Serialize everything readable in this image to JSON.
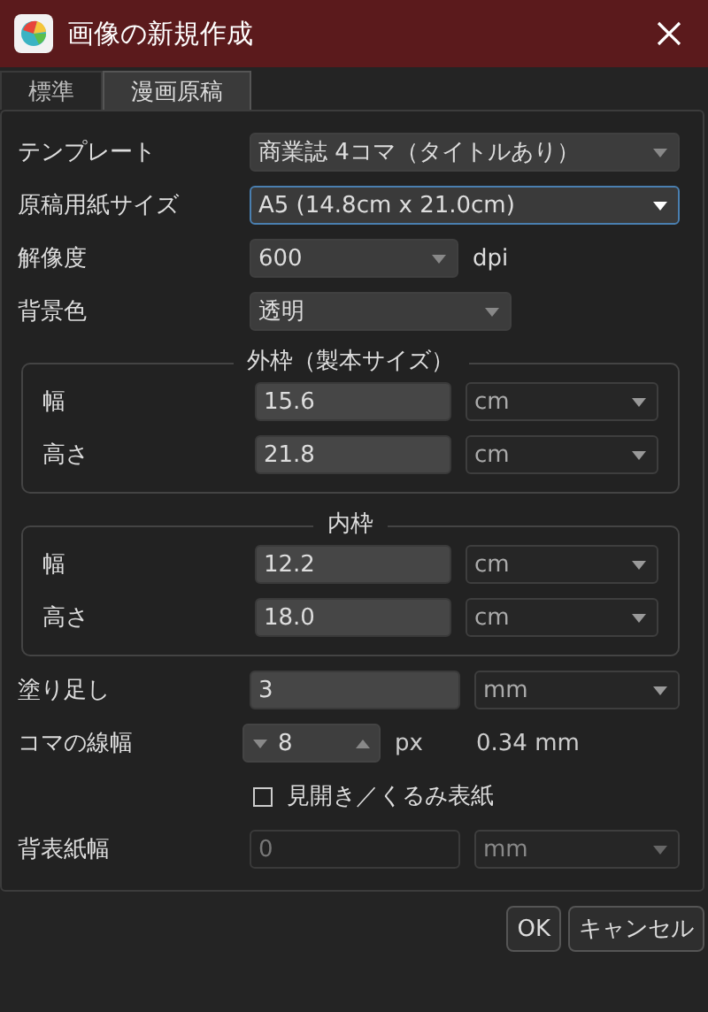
{
  "window": {
    "title": "画像の新規作成"
  },
  "tabs": [
    {
      "label": "標準",
      "selected": false
    },
    {
      "label": "漫画原稿",
      "selected": true
    }
  ],
  "rows": [
    {
      "kind": "select",
      "label": "テンプレート",
      "value": "商業誌 4コマ（タイトルあり）",
      "focused": false
    },
    {
      "kind": "select",
      "label": "原稿用紙サイズ",
      "value": "A5 (14.8cm x 21.0cm)",
      "focused": true
    },
    {
      "kind": "select",
      "label": "解像度",
      "value": "600",
      "unit": "dpi",
      "focused": false
    },
    {
      "kind": "select",
      "label": "背景色",
      "value": "透明",
      "focused": false
    },
    {
      "kind": "group",
      "title": "外枠（製本サイズ）",
      "rows": [
        {
          "label": "幅",
          "value": "15.6",
          "unit": "cm"
        },
        {
          "label": "高さ",
          "value": "21.8",
          "unit": "cm"
        }
      ]
    },
    {
      "kind": "group",
      "title": "内枠",
      "rows": [
        {
          "label": "幅",
          "value": "12.2",
          "unit": "cm"
        },
        {
          "label": "高さ",
          "value": "18.0",
          "unit": "cm"
        }
      ]
    },
    {
      "kind": "number",
      "label": "塗り足し",
      "value": "3",
      "unit": "mm",
      "disabled": false
    },
    {
      "kind": "spinner",
      "label": "コマの線幅",
      "value": "8",
      "unit": "px",
      "conversion": "0.34 mm"
    },
    {
      "kind": "checkbox",
      "label": "見開き／くるみ表紙",
      "checked": false
    },
    {
      "kind": "number",
      "label": "背表紙幅",
      "value": "0",
      "unit": "mm",
      "disabled": true
    }
  ],
  "buttons": [
    "OK",
    "キャンセル"
  ]
}
